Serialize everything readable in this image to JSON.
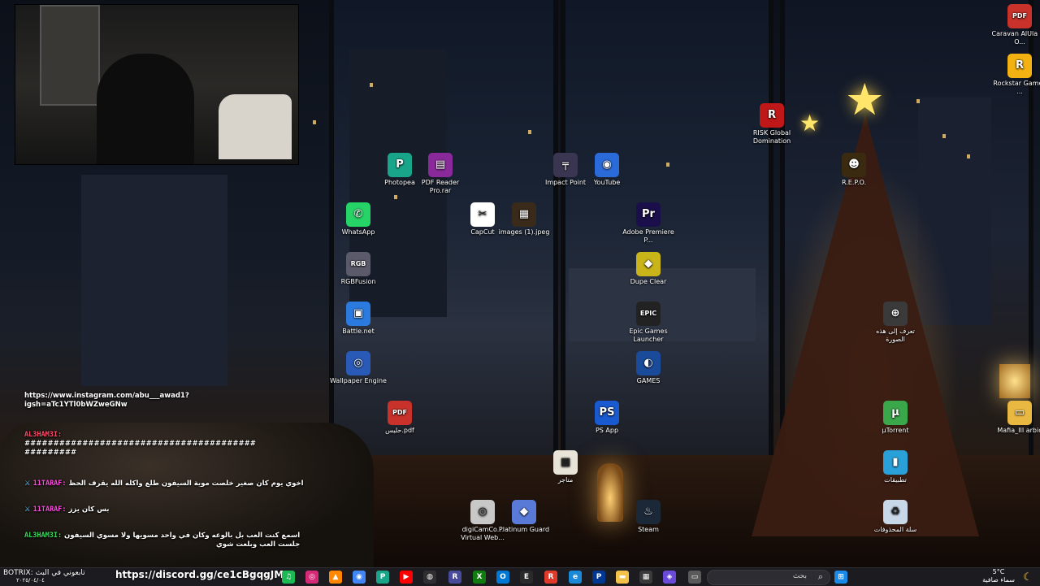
{
  "desktop_icons": [
    {
      "label": "Photopea",
      "color": "#18a589",
      "glyph": "P"
    },
    {
      "label": "PDF Reader Pro.rar",
      "color": "#8a2a9a",
      "glyph": "▤"
    },
    {
      "label": "Impact Point",
      "color": "#3a3550",
      "glyph": "╤"
    },
    {
      "label": "YouTube",
      "color": "#2a6ad9",
      "glyph": "◉"
    },
    {
      "label": "WhatsApp",
      "color": "#25d366",
      "glyph": "✆"
    },
    {
      "label": "CapCut",
      "color": "#ffffff",
      "glyph": "✂"
    },
    {
      "label": "images (1).jpeg",
      "color": "#3a2a1a",
      "glyph": "▦"
    },
    {
      "label": "Adobe Premiere P...",
      "color": "#1a0f4a",
      "glyph": "Pr"
    },
    {
      "label": "RGBFusion",
      "color": "#5a5a6a",
      "glyph": "RGB"
    },
    {
      "label": "Dupe Clear",
      "color": "#c9b41a",
      "glyph": "◆"
    },
    {
      "label": "Battle.net",
      "color": "#2a7ae0",
      "glyph": "▣"
    },
    {
      "label": "Epic Games Launcher",
      "color": "#222222",
      "glyph": "EPIC"
    },
    {
      "label": "Wallpaper Engine",
      "color": "#2a5ab8",
      "glyph": "◎"
    },
    {
      "label": "GAMES",
      "color": "#1a4a9a",
      "glyph": "◐"
    },
    {
      "label": "حليس.pdf",
      "color": "#c8322a",
      "glyph": "PDF"
    },
    {
      "label": "PS App",
      "color": "#1a5ad0",
      "glyph": "PS"
    },
    {
      "label": "متاجر",
      "color": "#e8e4d8",
      "glyph": "▦"
    },
    {
      "label": "digiCamCo... Virtual Web...",
      "color": "#c8c8c8",
      "glyph": "◎"
    },
    {
      "label": "Platinum Guard",
      "color": "#5a7ad8",
      "glyph": "◆"
    },
    {
      "label": "Steam",
      "color": "#1b2838",
      "glyph": "♨"
    },
    {
      "label": "Caravan AlUla by O...",
      "color": "#c8322a",
      "glyph": "PDF"
    },
    {
      "label": "Rockstar Games ...",
      "color": "#f3b212",
      "glyph": "R"
    },
    {
      "label": "RISK Global Domination",
      "color": "#c01818",
      "glyph": "R"
    },
    {
      "label": "R.E.P.O.",
      "color": "#3a2a10",
      "glyph": "☻"
    },
    {
      "label": "تعرف إلى هذه الصورة",
      "color": "#3a3a3a",
      "glyph": "⊕"
    },
    {
      "label": "µTorrent",
      "color": "#3aa84a",
      "glyph": "µ"
    },
    {
      "label": "تطبيقات",
      "color": "#2aa0d8",
      "glyph": "▮"
    },
    {
      "label": "Mafia_III arbic",
      "color": "#e8b840",
      "glyph": "▭"
    },
    {
      "label": "سلة المحذوفات",
      "color": "#c8d8e8",
      "glyph": "♻"
    }
  ],
  "chat": {
    "instagram_line1": "https://www.instagram.com/abu___awad1?",
    "instagram_line2": "igsh=aTc1YTl0bWZweGNw",
    "messages": [
      {
        "user": "AL3HAM3I:",
        "text": "########################################",
        "text2": "#########",
        "user_color": "#ff4a6a",
        "badge": ""
      },
      {
        "user": "11TARAF:",
        "text": "اخوي يوم كان صغير خلصت موية السيفون طلع واكله الله يقرف الحظ",
        "text2": "",
        "user_color": "#ff4adf",
        "badge": "⚔"
      },
      {
        "user": "11TARAF:",
        "text": "بس كان يزز",
        "text2": "",
        "user_color": "#ff4adf",
        "badge": "⚔"
      },
      {
        "user": "AL3HAM3I:",
        "text": "اسمع كنت العب بل بالوعه وكان في واحد مسويها ولا مسوي السيفون",
        "text2": "جلست العب وبلعت شوي",
        "user_color": "#3ad85a",
        "badge": "⚔"
      }
    ]
  },
  "taskbar": {
    "notification_text": "BOTRIX: تابعوني في البث",
    "discord_link": "https://discord.gg/ce1cBgqgJM",
    "date_text": "٢٠٢٥/٠٤/٠٤",
    "search_placeholder": "بحث",
    "temperature": "5°C",
    "weather_desc": "سماء صافية",
    "apps": [
      {
        "name": "spotify-icon",
        "color": "#1db954",
        "glyph": "♫"
      },
      {
        "name": "instagram-icon",
        "color": "#d62976",
        "glyph": "◎"
      },
      {
        "name": "vlc-icon",
        "color": "#ff8800",
        "glyph": "▲"
      },
      {
        "name": "chrome-icon",
        "color": "#4285f4",
        "glyph": "◉"
      },
      {
        "name": "photopea-icon",
        "color": "#18a589",
        "glyph": "P"
      },
      {
        "name": "youtube-icon",
        "color": "#ff0000",
        "glyph": "▶"
      },
      {
        "name": "obs-icon",
        "color": "#302e31",
        "glyph": "◍"
      },
      {
        "name": "rgb-icon",
        "color": "#4a4a9a",
        "glyph": "R"
      },
      {
        "name": "xbox-icon",
        "color": "#107c10",
        "glyph": "X"
      },
      {
        "name": "outlook-icon",
        "color": "#0078d4",
        "glyph": "O"
      },
      {
        "name": "epic-icon",
        "color": "#2a2a2a",
        "glyph": "E"
      },
      {
        "name": "rockstar-icon",
        "color": "#e03a2a",
        "glyph": "R"
      },
      {
        "name": "edge-icon",
        "color": "#1a8ad8",
        "glyph": "e"
      },
      {
        "name": "playstation-icon",
        "color": "#003791",
        "glyph": "P"
      },
      {
        "name": "explorer-icon",
        "color": "#f3c24a",
        "glyph": "▬"
      },
      {
        "name": "store-icon",
        "color": "#3a3a3a",
        "glyph": "▦"
      },
      {
        "name": "copilot-icon",
        "color": "#6a4ad8",
        "glyph": "◈"
      },
      {
        "name": "window-icon",
        "color": "#5a5a5a",
        "glyph": "▭"
      },
      {
        "name": "start-icon",
        "color": "#1a8ae8",
        "glyph": "⊞"
      }
    ]
  }
}
